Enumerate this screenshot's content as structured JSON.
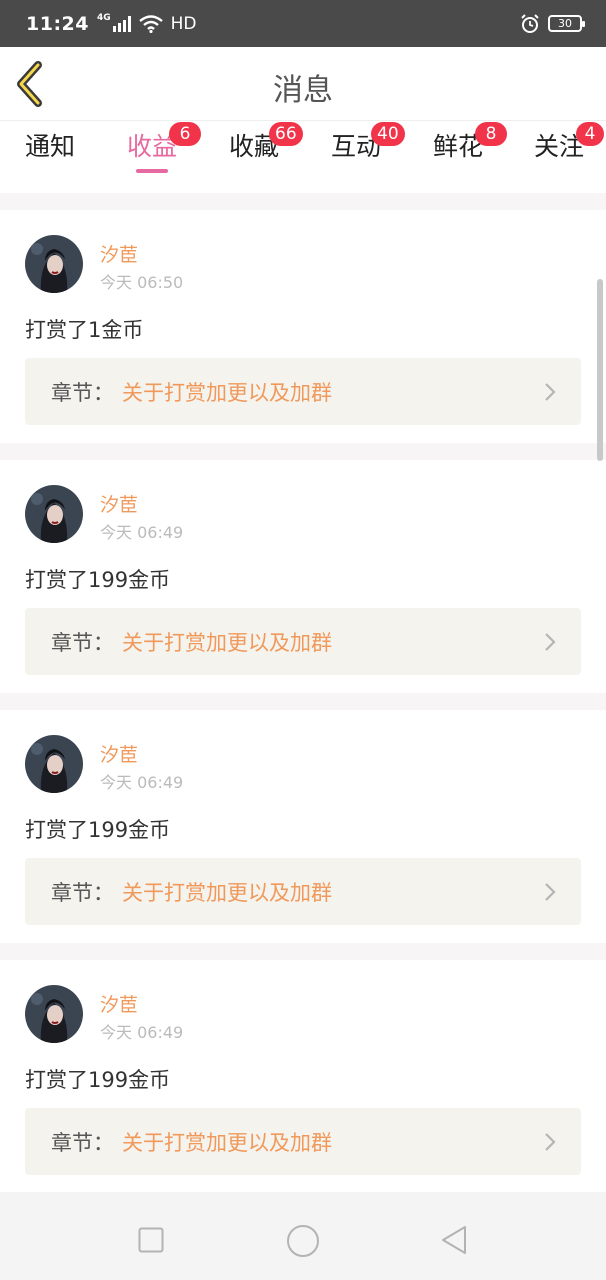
{
  "status_bar": {
    "time": "11:24",
    "network": "4G",
    "hd": "HD",
    "battery": "30",
    "icons": [
      "signal-icon",
      "wifi-icon",
      "alarm-icon",
      "battery-icon"
    ]
  },
  "header": {
    "title": "消息",
    "back_icon": "chevron-left-icon"
  },
  "tabs": [
    {
      "label": "通知",
      "badge": ""
    },
    {
      "label": "收益",
      "badge": "6",
      "active": true
    },
    {
      "label": "收藏",
      "badge": "66"
    },
    {
      "label": "互动",
      "badge": "40"
    },
    {
      "label": "鲜花",
      "badge": "8"
    },
    {
      "label": "关注",
      "badge": "4"
    }
  ],
  "messages": [
    {
      "user": "汐茞",
      "time": "今天 06:50",
      "text": "打赏了1金币",
      "chapter_prefix": "章节：",
      "chapter_title": "关于打赏加更以及加群"
    },
    {
      "user": "汐茞",
      "time": "今天 06:49",
      "text": "打赏了199金币",
      "chapter_prefix": "章节：",
      "chapter_title": "关于打赏加更以及加群"
    },
    {
      "user": "汐茞",
      "time": "今天 06:49",
      "text": "打赏了199金币",
      "chapter_prefix": "章节：",
      "chapter_title": "关于打赏加更以及加群"
    },
    {
      "user": "汐茞",
      "time": "今天 06:49",
      "text": "打赏了199金币",
      "chapter_prefix": "章节：",
      "chapter_title": "关于打赏加更以及加群"
    }
  ],
  "colors": {
    "accent_pink": "#e66a9f",
    "badge_red": "#f2344a",
    "username_orange": "#f0995b",
    "chapter_bg": "#f4f3ee"
  },
  "nav_buttons": [
    "square-icon",
    "circle-icon",
    "triangle-back-icon"
  ]
}
